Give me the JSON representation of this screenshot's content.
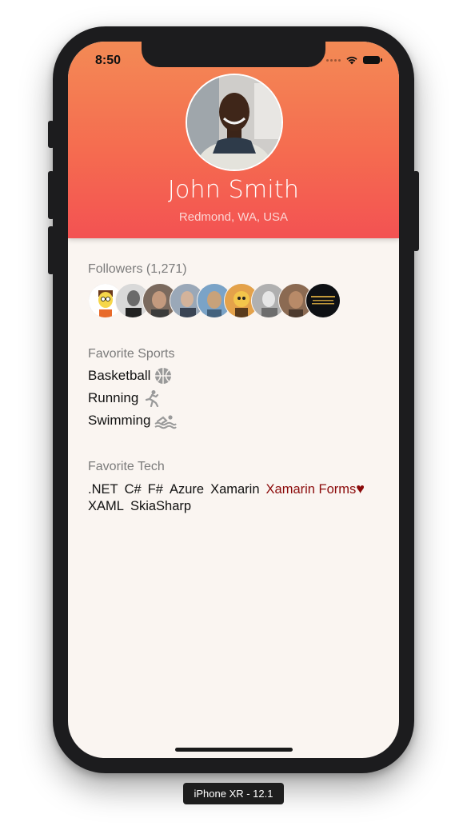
{
  "status_bar": {
    "time": "8:50"
  },
  "profile": {
    "name": "John Smith",
    "location": "Redmond, WA, USA"
  },
  "followers": {
    "title": "Followers (1,271)",
    "avatars": [
      "follower-1",
      "follower-2",
      "follower-3",
      "follower-4",
      "follower-5",
      "follower-6",
      "follower-7",
      "follower-8"
    ]
  },
  "sports": {
    "title": "Favorite Sports",
    "items": [
      {
        "label": "Basketball",
        "icon": "basketball-icon"
      },
      {
        "label": "Running",
        "icon": "running-icon"
      },
      {
        "label": "Swimming",
        "icon": "swimming-icon"
      }
    ]
  },
  "tech": {
    "title": "Favorite Tech",
    "items": [
      ".NET",
      "C#",
      "F#",
      "Azure",
      "Xamarin",
      "Xamarin Forms",
      "XAML",
      "SkiaSharp"
    ],
    "favorite": "Xamarin Forms",
    "favorite_color": "#8b0a0a"
  },
  "colors": {
    "header_top": "#f38a55",
    "header_bottom": "#f35252",
    "background": "#faf5f1"
  },
  "device_label": "iPhone XR - 12.1"
}
